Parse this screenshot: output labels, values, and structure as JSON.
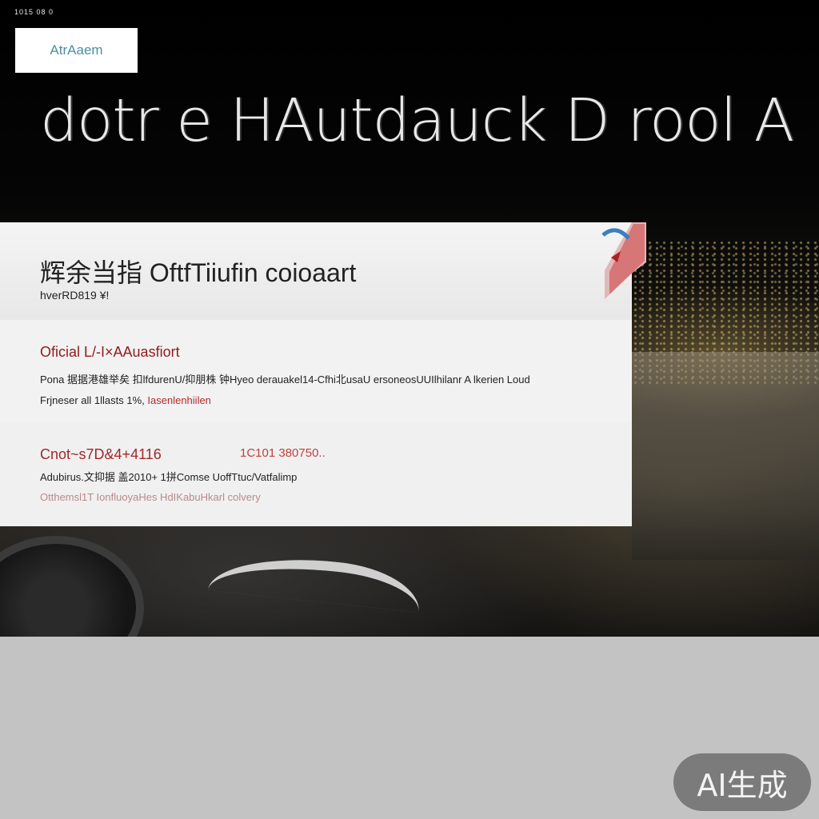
{
  "status_bar": {
    "text": "1015 08 0"
  },
  "top_button": {
    "label": "AtrAaem"
  },
  "hero": {
    "headline": "dotr e HAutdauck D rool A"
  },
  "panel": {
    "title": "辉余当指 OftfTiiufin coioaart",
    "subtitle": "hverRD819 ¥!",
    "section1": {
      "heading": "Oficial L/-I×AAuasfiort",
      "line1": "Pona 据据港雄举矣 扣lfdurenU/抑朋株 钟Hyeo derauakel14-Cfhi北usaU ersoneosUUIlhilanr A lkerien Loud",
      "line2_prefix": "Frjneser all 1llasts 1%,",
      "line2_link": "Iasenlenhiilen"
    },
    "section2": {
      "heading": "Cnot~s7D&4+4116",
      "right_value": "1C101 380750..",
      "line1": "Adubirus.文抑据 盖2010+ 1拼Comse UoffTtuc/Vatfalimp",
      "line2": "Otthemsl1T IonfluoyaHes HdIKabuHkarl colvery"
    }
  },
  "badge": {
    "text": "AI生成"
  },
  "colors": {
    "accent_red": "#8f1c1c",
    "link_red": "#b52a2a",
    "button_text": "#4a8fa0",
    "panel_bg": "#efefef",
    "lower_bg": "#c3c3c3"
  }
}
